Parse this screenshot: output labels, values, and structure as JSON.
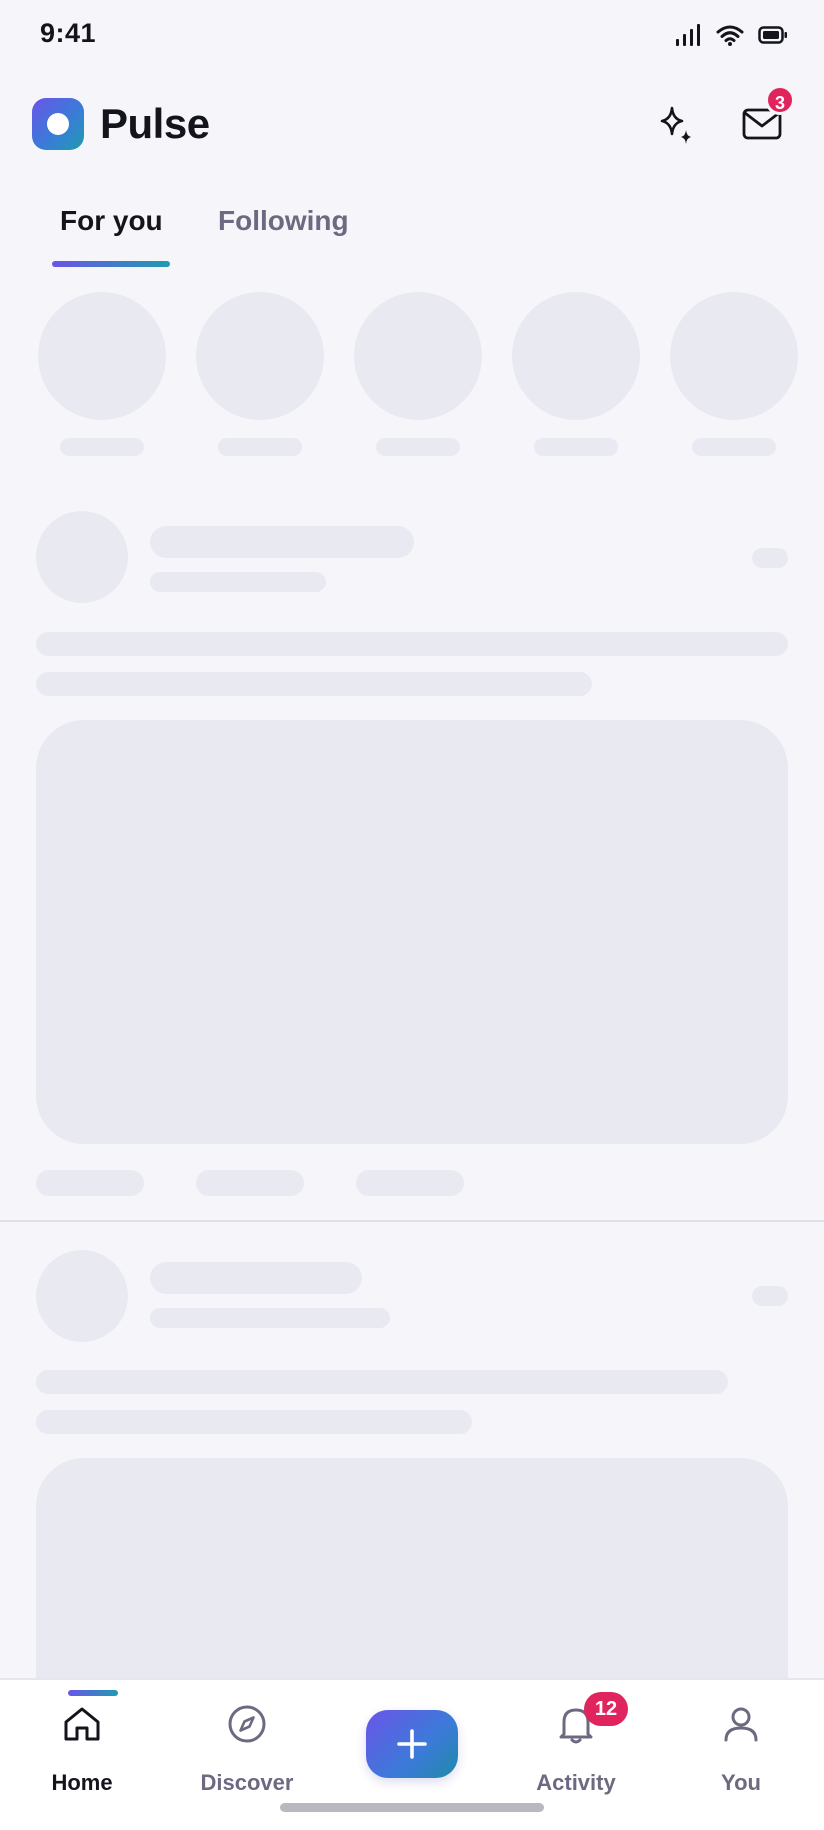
{
  "status_bar": {
    "time": "9:41",
    "icons": [
      "signal-icon",
      "wifi-icon",
      "battery-icon"
    ]
  },
  "header": {
    "app_name": "Pulse",
    "logo_icon": "pulse-logo",
    "actions": [
      {
        "icon": "sparkle-icon"
      },
      {
        "icon": "mail-icon",
        "badge": "3"
      }
    ]
  },
  "tabs": [
    {
      "label": "For you",
      "active": true
    },
    {
      "label": "Following",
      "active": false
    }
  ],
  "feed": {
    "state": "loading-skeleton"
  },
  "bottom_nav": {
    "items": [
      {
        "label": "Home",
        "icon": "home-icon",
        "active": true
      },
      {
        "label": "Discover",
        "icon": "compass-icon",
        "active": false
      },
      {
        "label": "",
        "icon": "plus-icon",
        "active": false
      },
      {
        "label": "Activity",
        "icon": "bell-icon",
        "badge": "12",
        "active": false
      },
      {
        "label": "You",
        "icon": "user-icon",
        "active": false
      }
    ]
  },
  "colors": {
    "background": "#f6f6fa",
    "accent_start": "#6a55e8",
    "accent_end": "#1f9bb0",
    "badge": "#e0245e",
    "skeleton": "#e9e9f1",
    "muted_text": "#6c6a80"
  }
}
